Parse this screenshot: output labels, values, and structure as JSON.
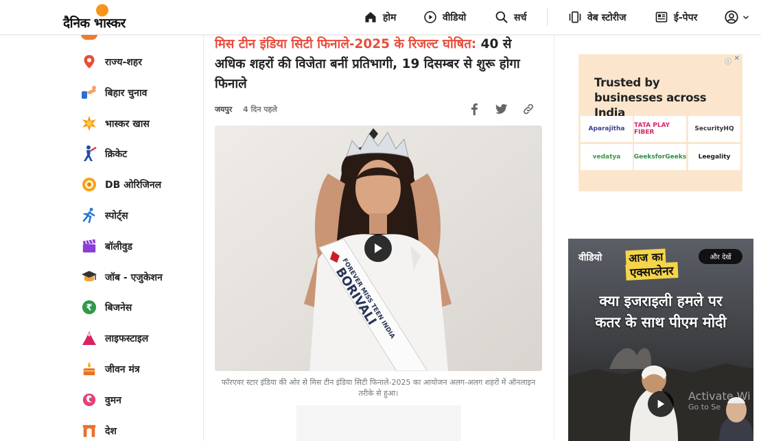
{
  "header": {
    "logo_text": "दैनिक भास्कर",
    "nav": [
      {
        "label": "होम",
        "icon": "home-icon"
      },
      {
        "label": "वीडियो",
        "icon": "play-circle-icon"
      },
      {
        "label": "सर्च",
        "icon": "search-icon"
      },
      {
        "label": "वेब स्टोरीज",
        "icon": "web-stories-icon"
      },
      {
        "label": "ई-पेपर",
        "icon": "newspaper-icon"
      }
    ],
    "profile_icon": "user-circle-icon",
    "chevron_icon": "chevron-down-icon"
  },
  "sidebar": {
    "items": [
      {
        "label": "राज्य-शहर",
        "icon": "location-pin-icon"
      },
      {
        "label": "बिहार चुनाव",
        "icon": "election-hand-icon"
      },
      {
        "label": "भास्कर खास",
        "icon": "star-burst-icon"
      },
      {
        "label": "क्रिकेट",
        "icon": "cricket-icon"
      },
      {
        "label": "DB ओरिजिनल",
        "icon": "db-original-icon"
      },
      {
        "label": "स्पोर्ट्स",
        "icon": "running-icon"
      },
      {
        "label": "बॉलीवुड",
        "icon": "clapperboard-icon"
      },
      {
        "label": "जॉब - एजुकेशन",
        "icon": "graduation-cap-icon"
      },
      {
        "label": "बिजनेस",
        "icon": "rupee-coin-icon"
      },
      {
        "label": "लाइफस्टाइल",
        "icon": "lifestyle-icon"
      },
      {
        "label": "जीवन मंत्र",
        "icon": "diya-icon"
      },
      {
        "label": "वुमन",
        "icon": "woman-icon"
      },
      {
        "label": "देश",
        "icon": "india-gate-icon"
      }
    ]
  },
  "article": {
    "title_highlight": "मिस टीन इंडिया सिटी फिनाले-2025 के रिजल्ट घोषित:",
    "title_rest": " 40 से अधिक शहरों की विजेता बनीं प्रतिभागी, 19 दिसम्बर से शुरू होगा फिनाले",
    "location": "जयपुर",
    "time_ago": "4 दिन पहले",
    "share_icons": [
      "facebook-icon",
      "twitter-icon",
      "link-icon"
    ],
    "sash_text": "FOREVER MISS TEEN INDIA",
    "sash_city": "BORIVALI",
    "caption": "फॉरएवर स्टार इंडिया की ओर से मिस टीन इंडिया सिटी फिनाले-2025 का आयोजन अलग-अलग शहरों में ऑनलाइन तरीके से हुआ।"
  },
  "ad": {
    "headline": "Trusted by businesses across India",
    "info_icon": "ⓘ",
    "close_icon": "✕",
    "logos": [
      "Aparajitha",
      "TATA PLAY FIBER",
      "SecurityHQ",
      "vedatya",
      "GeeksforGeeks",
      "Leegality"
    ]
  },
  "video_widget": {
    "label": "वीडियो",
    "see_all": "और देखें",
    "show_line1": "आज का",
    "show_line2": "एक्सप्लेनर",
    "headline_line1": "क्या इजराइली हमले पर",
    "headline_line2": "कतर के साथ पीएम मोदी"
  },
  "watermark": {
    "line1": "Activate Wi",
    "line2": "Go to Se"
  },
  "colors": {
    "accent_red": "#ea4c3a",
    "logo_sun": "#f7941d",
    "ad_bg": "#fbe6cd",
    "video_bg": "#2a2a2a"
  }
}
